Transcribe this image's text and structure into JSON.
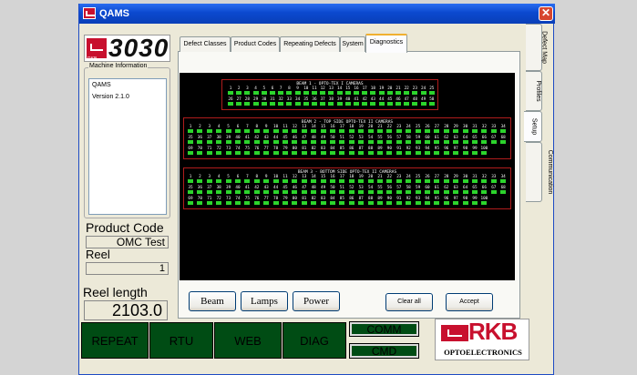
{
  "window": {
    "title": "QAMS",
    "close_glyph": "✕"
  },
  "logo": {
    "number": "3030",
    "mark_text": "RKB"
  },
  "machine_info": {
    "label": "Machine Information",
    "lines": [
      "QAMS",
      "Version 2.1.0"
    ]
  },
  "product_code": {
    "label": "Product Code",
    "value": "OMC Test"
  },
  "reel": {
    "label": "Reel",
    "value": "1"
  },
  "reel_length": {
    "label": "Reel length",
    "value": "2103.0"
  },
  "tabs": [
    "Defect Classes",
    "Product Codes",
    "Repeating Defects",
    "System",
    "Diagnostics"
  ],
  "active_tab": "Diagnostics",
  "side_tabs": [
    "Defect Map",
    "Profiles",
    "Setup",
    "Communication"
  ],
  "active_side_tab": "Setup",
  "beams": [
    {
      "title": "BEAM 1 - OPTO-TEX I CAMERAS",
      "count": 50
    },
    {
      "title": "BEAM 2 - TOP SIDE OPTO-TEX II CAMERAS",
      "count": 100
    },
    {
      "title": "BEAM 3 - BOTTOM SIDE OPTO-TEX II CAMERAS",
      "count": 100
    }
  ],
  "camera_status_color": "#2cd42c",
  "buttons": {
    "beam": "Beam",
    "lamps": "Lamps",
    "power": "Power",
    "clear_all": "Clear all",
    "accept": "Accept"
  },
  "bottom_buttons": [
    "REPEAT",
    "RTU",
    "WEB",
    "DIAG"
  ],
  "status_bars": {
    "comm": "COMM",
    "cmd": "CMD"
  },
  "brand": {
    "name": "RKB",
    "sub": "OPTOELECTRONICS"
  }
}
